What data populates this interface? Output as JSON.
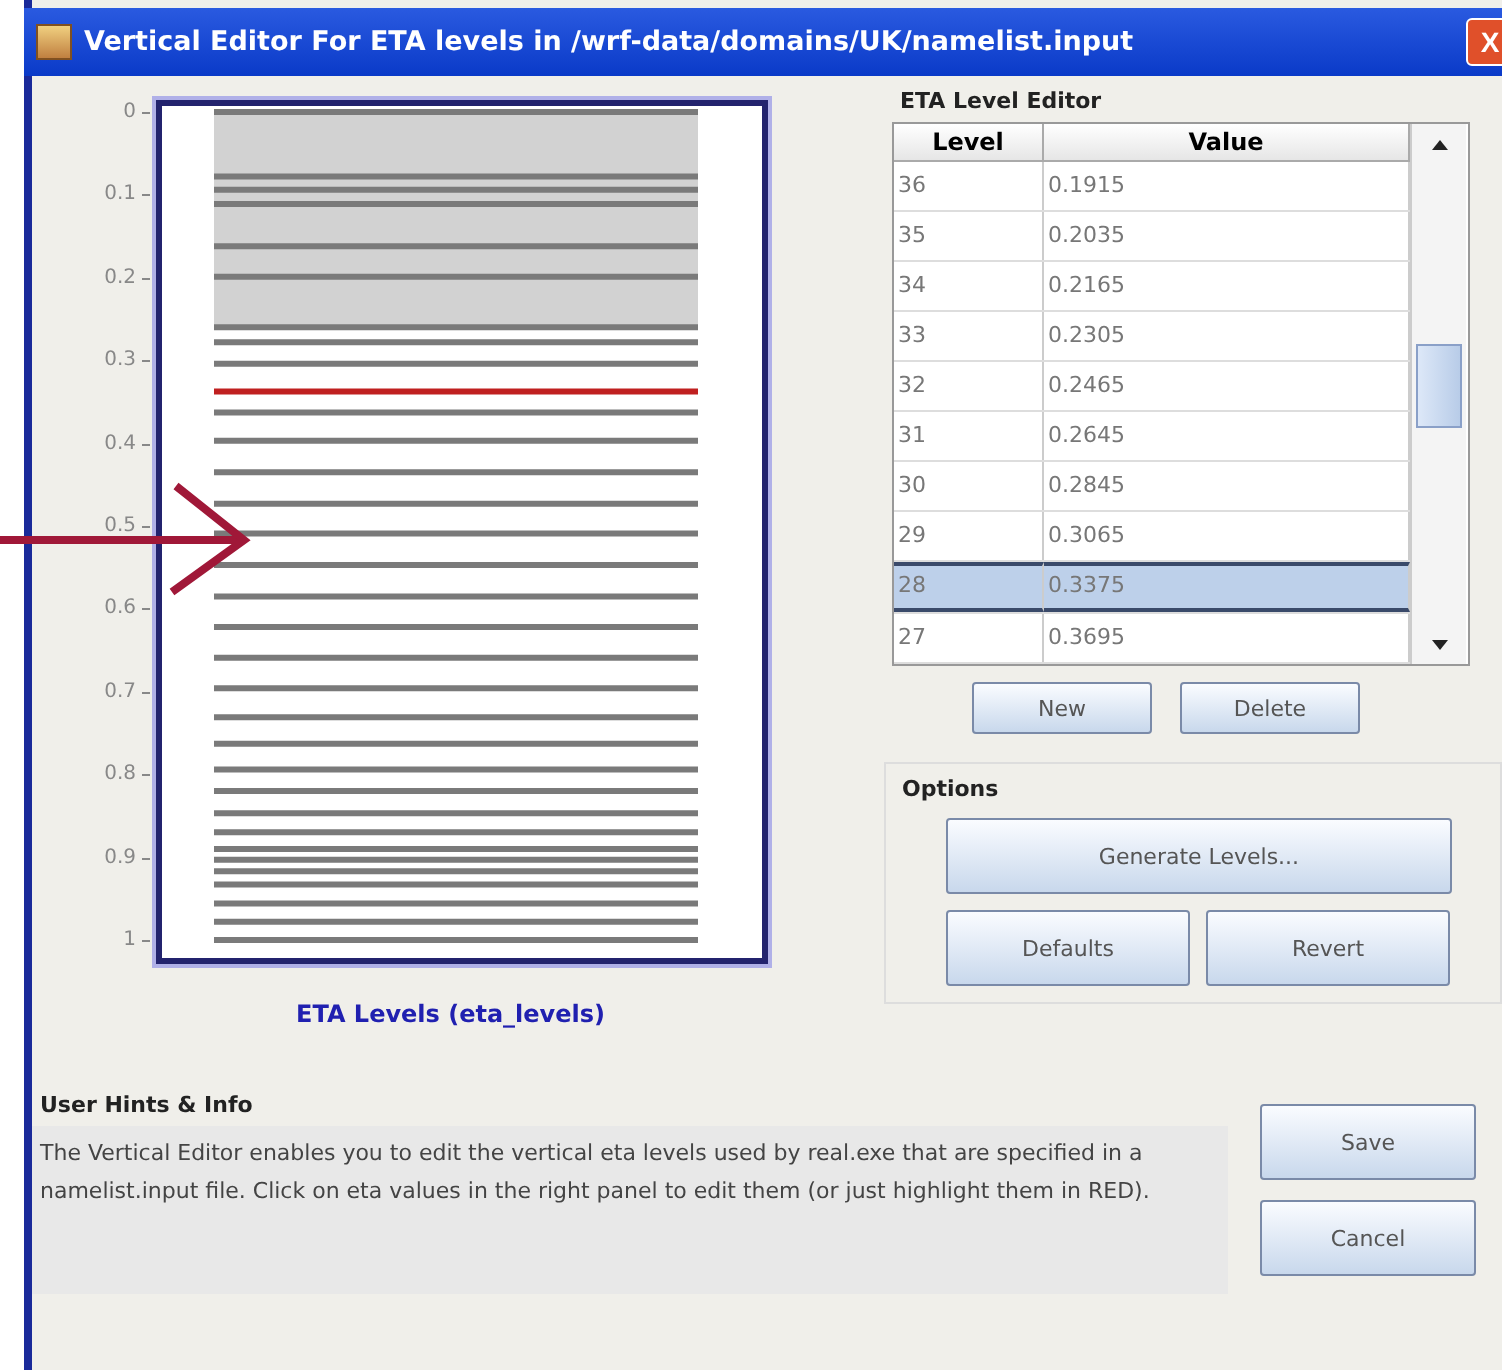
{
  "window": {
    "title": "Vertical Editor For ETA levels in /wrf-data/domains/UK/namelist.input",
    "close": "X"
  },
  "plot": {
    "caption": "ETA Levels (eta_levels)",
    "tick_labels": [
      "0",
      "0.1",
      "0.2",
      "0.3",
      "0.4",
      "0.5",
      "0.6",
      "0.7",
      "0.8",
      "0.9",
      "1"
    ]
  },
  "level_editor": {
    "title": "ETA Level Editor",
    "columns": [
      "Level",
      "Value"
    ],
    "rows": [
      {
        "level": "36",
        "value": "0.1915",
        "selected": false
      },
      {
        "level": "35",
        "value": "0.2035",
        "selected": false
      },
      {
        "level": "34",
        "value": "0.2165",
        "selected": false
      },
      {
        "level": "33",
        "value": "0.2305",
        "selected": false
      },
      {
        "level": "32",
        "value": "0.2465",
        "selected": false
      },
      {
        "level": "31",
        "value": "0.2645",
        "selected": false
      },
      {
        "level": "30",
        "value": "0.2845",
        "selected": false
      },
      {
        "level": "29",
        "value": "0.3065",
        "selected": false
      },
      {
        "level": "28",
        "value": "0.3375",
        "selected": true
      },
      {
        "level": "27",
        "value": "0.3695",
        "selected": false
      }
    ],
    "buttons": [
      "New",
      "Delete"
    ]
  },
  "options": {
    "title": "Options",
    "generate": "Generate Levels...",
    "buttons": [
      "Defaults",
      "Revert"
    ]
  },
  "hints": {
    "title": "User Hints & Info",
    "text": "The Vertical Editor enables you to edit the vertical eta levels used by real.exe that are specified in a namelist.input file. Click on eta values in the right panel to edit them (or just highlight them in RED)."
  },
  "actions": [
    "Save",
    "Cancel"
  ]
}
